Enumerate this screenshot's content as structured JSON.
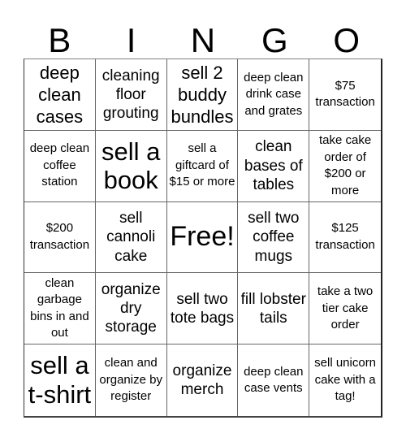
{
  "header": {
    "letters": [
      "B",
      "I",
      "N",
      "G",
      "O"
    ]
  },
  "cells": [
    {
      "text": "deep clean cases",
      "size": "l"
    },
    {
      "text": "cleaning floor grouting",
      "size": "m"
    },
    {
      "text": "sell 2 buddy bundles",
      "size": "l"
    },
    {
      "text": "deep clean drink case and grates",
      "size": "s"
    },
    {
      "text": "$75 transaction",
      "size": "s"
    },
    {
      "text": "deep clean coffee station",
      "size": "s"
    },
    {
      "text": "sell a book",
      "size": "xl"
    },
    {
      "text": "sell a giftcard of $15 or more",
      "size": "s"
    },
    {
      "text": "clean bases of tables",
      "size": "m"
    },
    {
      "text": "take cake order of $200 or more",
      "size": "s"
    },
    {
      "text": "$200 transaction",
      "size": "s"
    },
    {
      "text": "sell cannoli cake",
      "size": "m"
    },
    {
      "text": "Free!",
      "size": "free"
    },
    {
      "text": "sell two coffee mugs",
      "size": "m"
    },
    {
      "text": "$125 transaction",
      "size": "s"
    },
    {
      "text": "clean garbage bins in and out",
      "size": "s"
    },
    {
      "text": "organize dry storage",
      "size": "m"
    },
    {
      "text": "sell two tote bags",
      "size": "m"
    },
    {
      "text": "fill lobster tails",
      "size": "m"
    },
    {
      "text": "take a two tier cake order",
      "size": "s"
    },
    {
      "text": "sell a t-shirt",
      "size": "xl"
    },
    {
      "text": "clean and organize by register",
      "size": "s"
    },
    {
      "text": "organize merch",
      "size": "m"
    },
    {
      "text": "deep clean case vents",
      "size": "s"
    },
    {
      "text": "sell unicorn cake with a tag!",
      "size": "s"
    }
  ]
}
